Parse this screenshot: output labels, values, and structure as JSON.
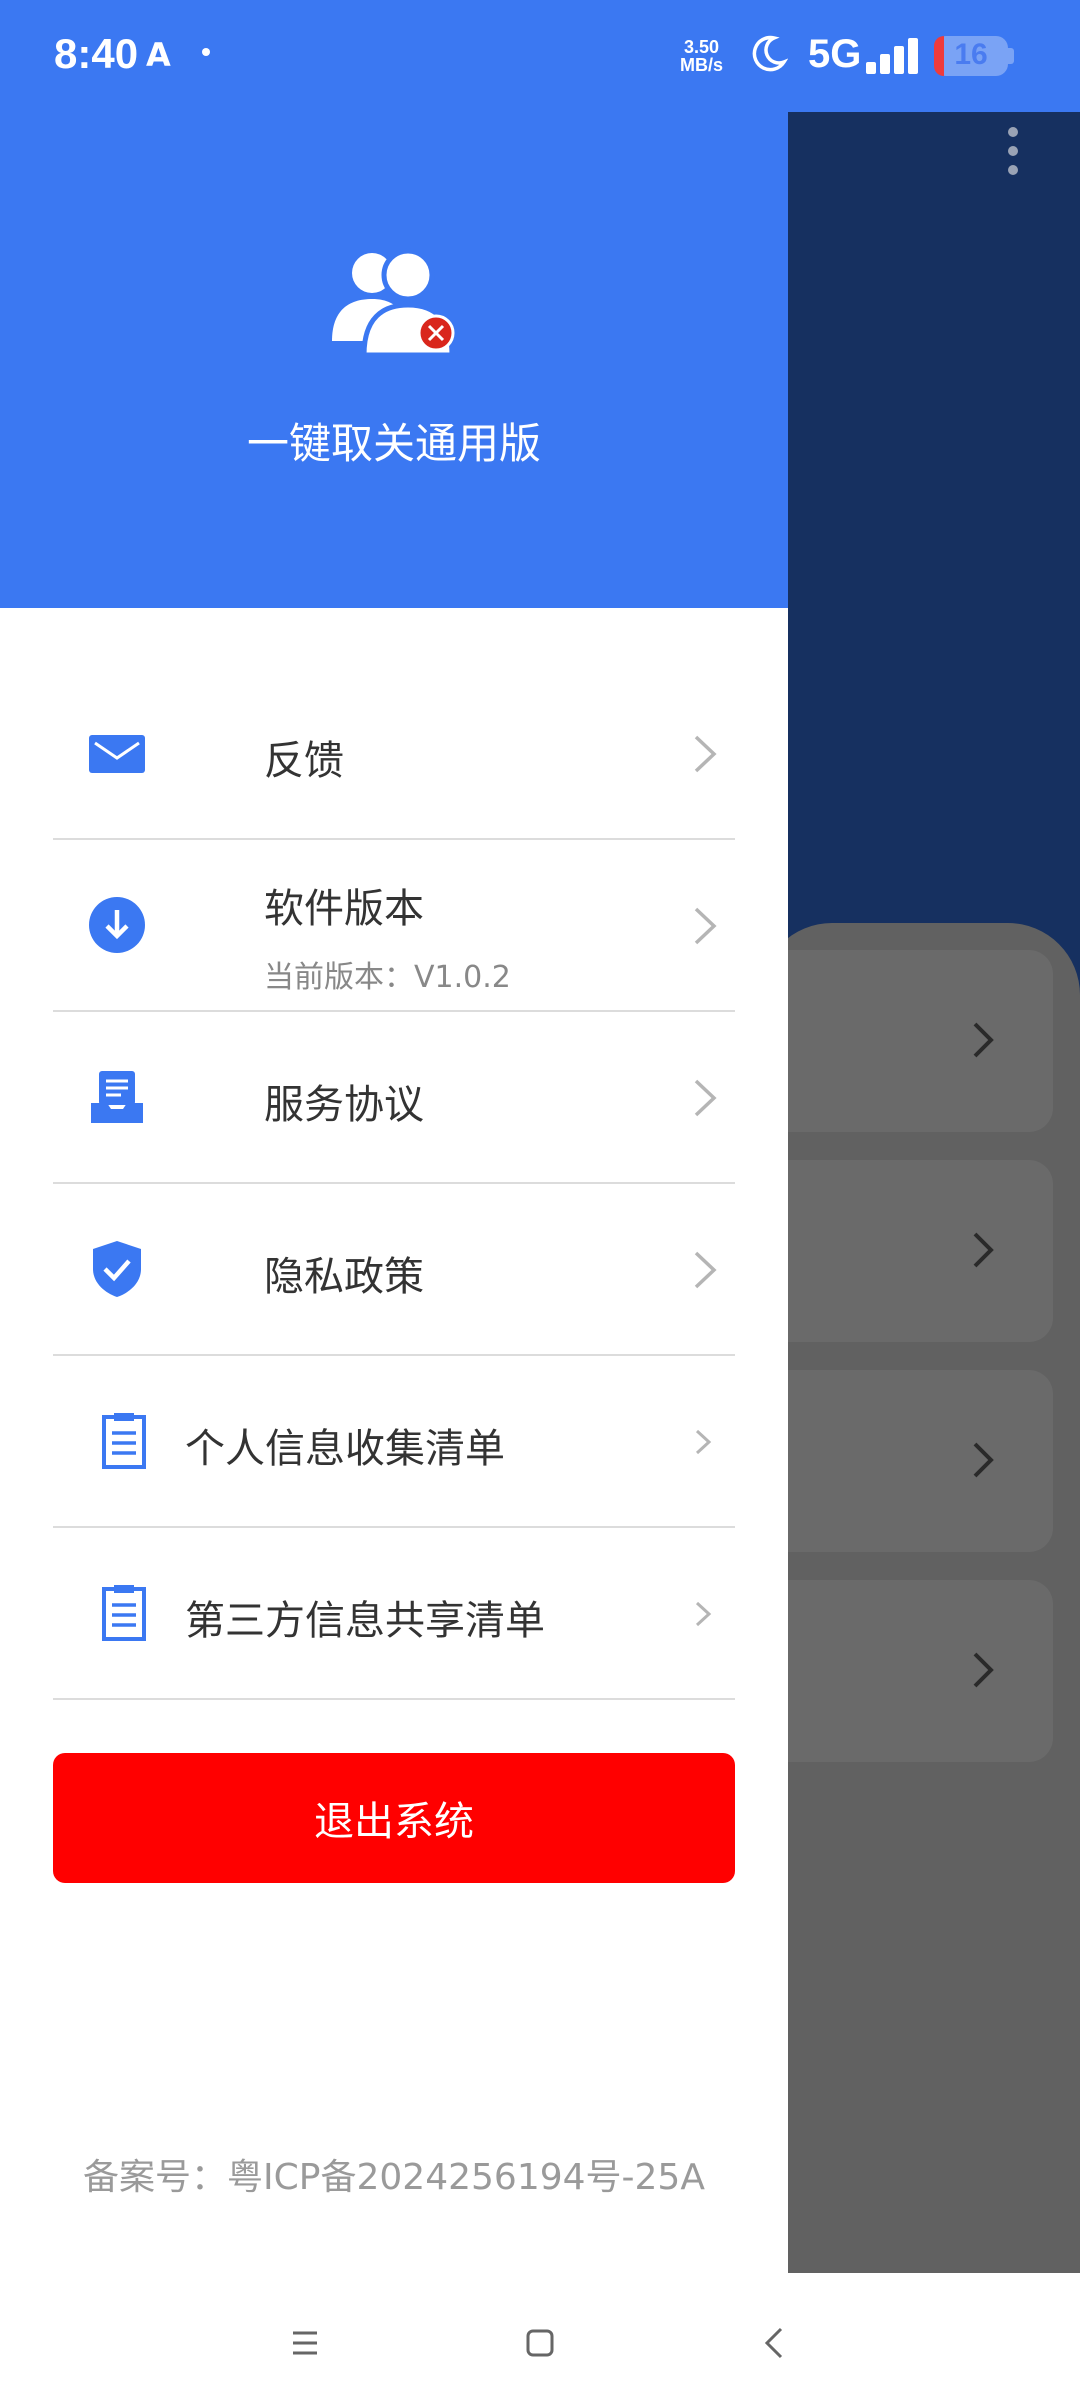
{
  "status_bar": {
    "time": "8:40",
    "a_icon": "A",
    "net_speed_value": "3.50",
    "net_speed_unit": "MB/s",
    "network": "5G",
    "battery": "16"
  },
  "drawer": {
    "app_name": "一键取关通用版",
    "menu": [
      {
        "label": "反馈",
        "icon": "mail-icon"
      },
      {
        "label": "软件版本",
        "sublabel": "当前版本：V1.0.2",
        "icon": "download-icon"
      },
      {
        "label": "服务协议",
        "icon": "document-tray-icon"
      },
      {
        "label": "隐私政策",
        "icon": "shield-check-icon"
      },
      {
        "label": "个人信息收集清单",
        "icon": "clipboard-list-icon"
      },
      {
        "label": "第三方信息共享清单",
        "icon": "clipboard-list-icon"
      }
    ],
    "logout_label": "退出系统",
    "icp": "备案号：粤ICP备2024256194号-25A"
  },
  "colors": {
    "primary": "#3b78f2",
    "logout": "#ff0000",
    "overlay_header": "#163060",
    "overlay_body": "#606060"
  }
}
